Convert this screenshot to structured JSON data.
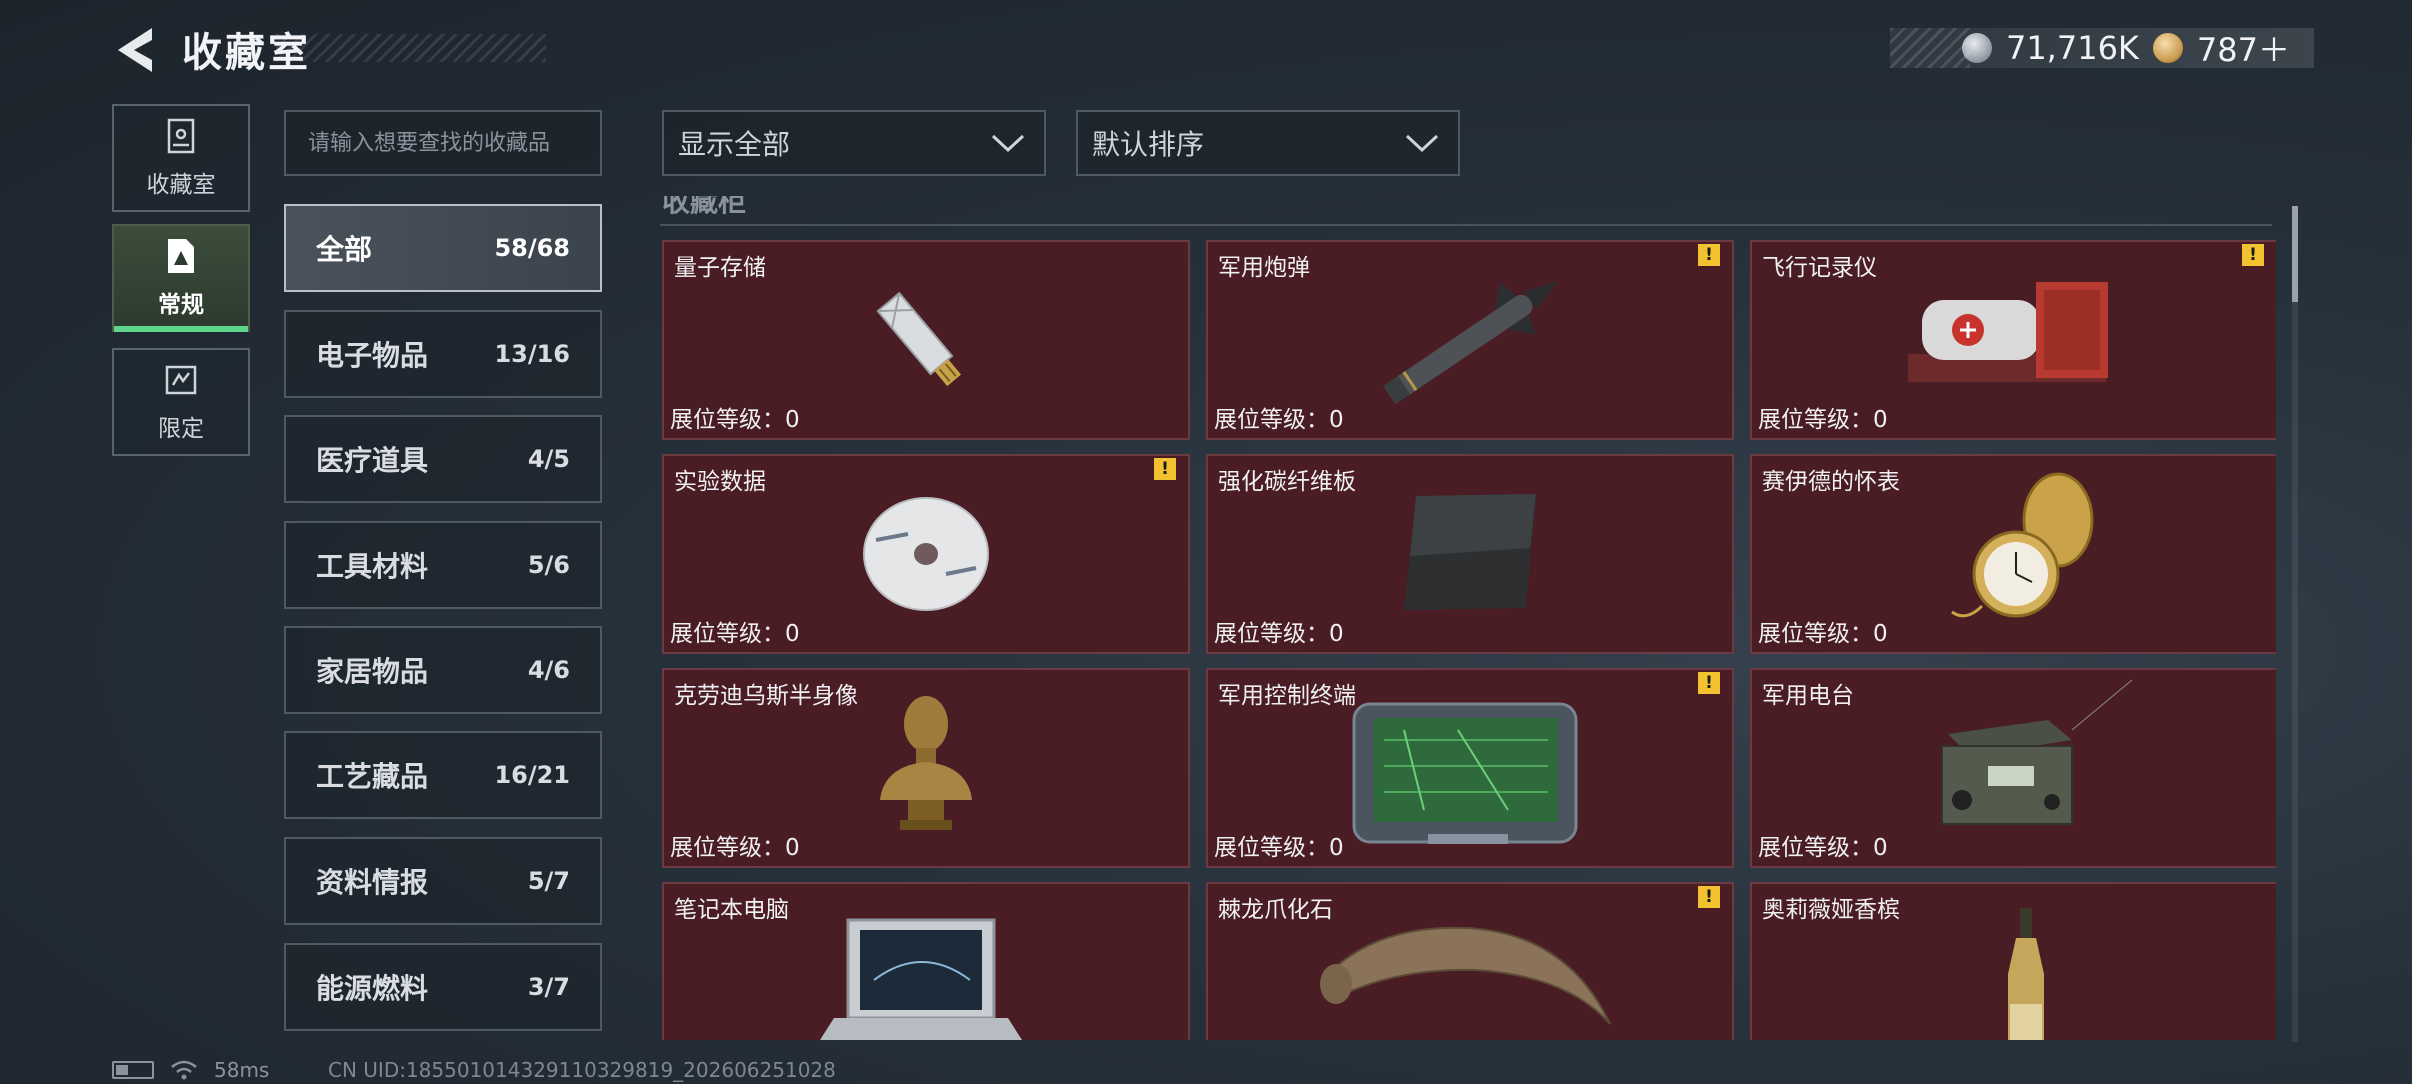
{
  "header": {
    "title": "收藏室",
    "back_icon": "back-arrow-icon",
    "currencies": [
      {
        "icon": "silver-coin-icon",
        "value": "71,716K"
      },
      {
        "icon": "gold-coin-icon",
        "value": "787＋"
      }
    ]
  },
  "side_nav": {
    "items": [
      {
        "label": "收藏室",
        "icon": "trophy-case-icon",
        "active": false
      },
      {
        "label": "常规",
        "icon": "document-icon",
        "active": true
      },
      {
        "label": "限定",
        "icon": "limited-icon",
        "active": false
      }
    ]
  },
  "search": {
    "placeholder": "请输入想要查找的收藏品",
    "value": ""
  },
  "categories": [
    {
      "name": "全部",
      "count": "58/68",
      "active": true
    },
    {
      "name": "电子物品",
      "count": "13/16",
      "active": false
    },
    {
      "name": "医疗道具",
      "count": "4/5",
      "active": false
    },
    {
      "name": "工具材料",
      "count": "5/6",
      "active": false
    },
    {
      "name": "家居物品",
      "count": "4/6",
      "active": false
    },
    {
      "name": "工艺藏品",
      "count": "16/21",
      "active": false
    },
    {
      "name": "资料情报",
      "count": "5/7",
      "active": false
    },
    {
      "name": "能源燃料",
      "count": "3/7",
      "active": false
    }
  ],
  "filters": {
    "display": "显示全部",
    "sort": "默认排序"
  },
  "section_title": "收藏柜",
  "items": [
    {
      "name": "量子存储",
      "level": "展位等级：0",
      "alert": false,
      "icon": "usb-drive-icon"
    },
    {
      "name": "军用炮弹",
      "level": "展位等级：0",
      "alert": true,
      "icon": "missile-icon"
    },
    {
      "name": "飞行记录仪",
      "level": "展位等级：0",
      "alert": true,
      "icon": "flight-recorder-icon"
    },
    {
      "name": "实验数据",
      "level": "展位等级：0",
      "alert": true,
      "icon": "disc-icon"
    },
    {
      "name": "强化碳纤维板",
      "level": "展位等级：0",
      "alert": false,
      "icon": "carbon-plate-icon"
    },
    {
      "name": "赛伊德的怀表",
      "level": "展位等级：0",
      "alert": false,
      "icon": "pocket-watch-icon"
    },
    {
      "name": "克劳迪乌斯半身像",
      "level": "展位等级：0",
      "alert": false,
      "icon": "bust-icon"
    },
    {
      "name": "军用控制终端",
      "level": "展位等级：0",
      "alert": true,
      "icon": "control-terminal-icon"
    },
    {
      "name": "军用电台",
      "level": "展位等级：0",
      "alert": false,
      "icon": "radio-icon"
    },
    {
      "name": "笔记本电脑",
      "level": "",
      "alert": false,
      "icon": "laptop-icon"
    },
    {
      "name": "棘龙爪化石",
      "level": "",
      "alert": true,
      "icon": "claw-fossil-icon"
    },
    {
      "name": "奥莉薇娅香槟",
      "level": "",
      "alert": false,
      "icon": "champagne-icon"
    }
  ],
  "alert_mark": "!",
  "status_bar": {
    "ping": "58ms",
    "uid": "CN UID:18550101432911032981​9_202606251028"
  }
}
